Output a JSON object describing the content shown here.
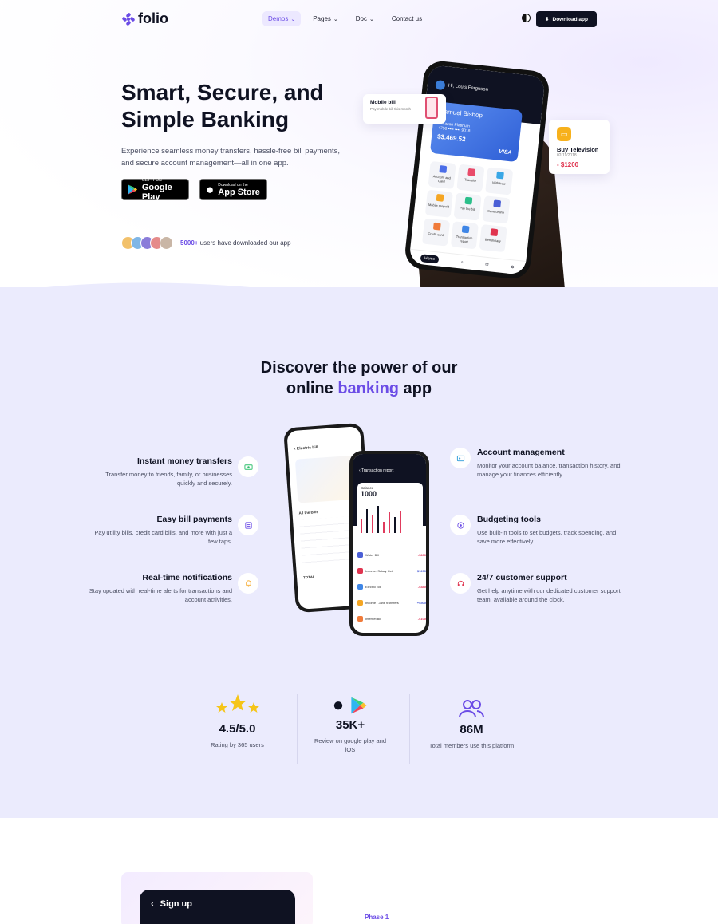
{
  "brand": {
    "name": "folio",
    "accent": "#6b4ce6",
    "dark": "#0f1222"
  },
  "nav": {
    "items": [
      {
        "label": "Demos",
        "active": true
      },
      {
        "label": "Pages"
      },
      {
        "label": "Doc"
      },
      {
        "label": "Contact us"
      }
    ],
    "download_label": "Download app"
  },
  "hero": {
    "title": "Smart, Secure, and Simple Banking",
    "subtitle": "Experience seamless money transfers, hassle-free bill payments, and secure account management—all in one app.",
    "google_play": {
      "small": "GET IT ON",
      "big": "Google Play"
    },
    "app_store": {
      "small": "Download on the",
      "big": "App Store"
    },
    "users_count": "5000+",
    "users_text": "users have downloaded our app"
  },
  "phone_hero": {
    "greeting": "Hi, Louis Ferguson",
    "card_name": "Samuel Bishop",
    "card_label": "Amazon Platinum",
    "card_number": "4756  ••••  ••••  9018",
    "card_balance": "$3.469.52",
    "card_brand": "VISA",
    "tiles": [
      "Account and Card",
      "Transfer",
      "Withdraw",
      "Mobile prepaid",
      "Pay the bill",
      "Save online",
      "Credit card",
      "Transaction report",
      "Beneficiary"
    ],
    "tab_home": "Home"
  },
  "float_bill": {
    "title": "Mobile bill",
    "sub": "Pay mobile bill this month"
  },
  "float_tv": {
    "title": "Buy Television",
    "date": "02/11/2018",
    "amount": "- $1200"
  },
  "features": {
    "title_pre": "Discover the power of our",
    "title_mid": "online ",
    "title_hl": "banking",
    "title_post": " app",
    "left": [
      {
        "title": "Instant money transfers",
        "text": "Transfer money to friends, family, or businesses quickly and securely.",
        "icon": "money-icon"
      },
      {
        "title": "Easy bill payments",
        "text": "Pay utility bills, credit card bills, and more with just a few taps.",
        "icon": "bill-icon"
      },
      {
        "title": "Real-time notifications",
        "text": "Stay updated with real-time alerts for transactions and account activities.",
        "icon": "bell-icon"
      }
    ],
    "right": [
      {
        "title": "Account management",
        "text": "Monitor your account balance, transaction history, and manage your finances efficiently.",
        "icon": "account-icon"
      },
      {
        "title": "Budgeting tools",
        "text": "Use built-in tools to set budgets, track spending, and save more effectively.",
        "icon": "target-icon"
      },
      {
        "title": "24/7 customer support",
        "text": "Get help anytime with our dedicated customer support team, available around the clock.",
        "icon": "headset-icon"
      }
    ]
  },
  "phone_a": {
    "title": "Electric bill",
    "section": "All the Bills",
    "total_label": "TOTAL"
  },
  "phone_b": {
    "title": "Transaction report",
    "balance_label": "Balance",
    "balance": "1000",
    "rows": [
      {
        "name": "Water Bill",
        "amount": "-$280"
      },
      {
        "name": "Income: Salary Oct",
        "amount": "+$1200"
      },
      {
        "name": "Electric Bill",
        "amount": "-$480"
      },
      {
        "name": "Income : Jane transfers",
        "amount": "+$500"
      },
      {
        "name": "Internet Bill",
        "amount": "-$100"
      }
    ]
  },
  "stats": [
    {
      "value": "4.5/5.0",
      "label": "Rating by 365 users"
    },
    {
      "value": "35K+",
      "label": "Review on google play and iOS"
    },
    {
      "value": "86M",
      "label": "Total members use this platform"
    }
  ],
  "bottom": {
    "signup_title": "Sign up",
    "phase": "Phase 1"
  }
}
